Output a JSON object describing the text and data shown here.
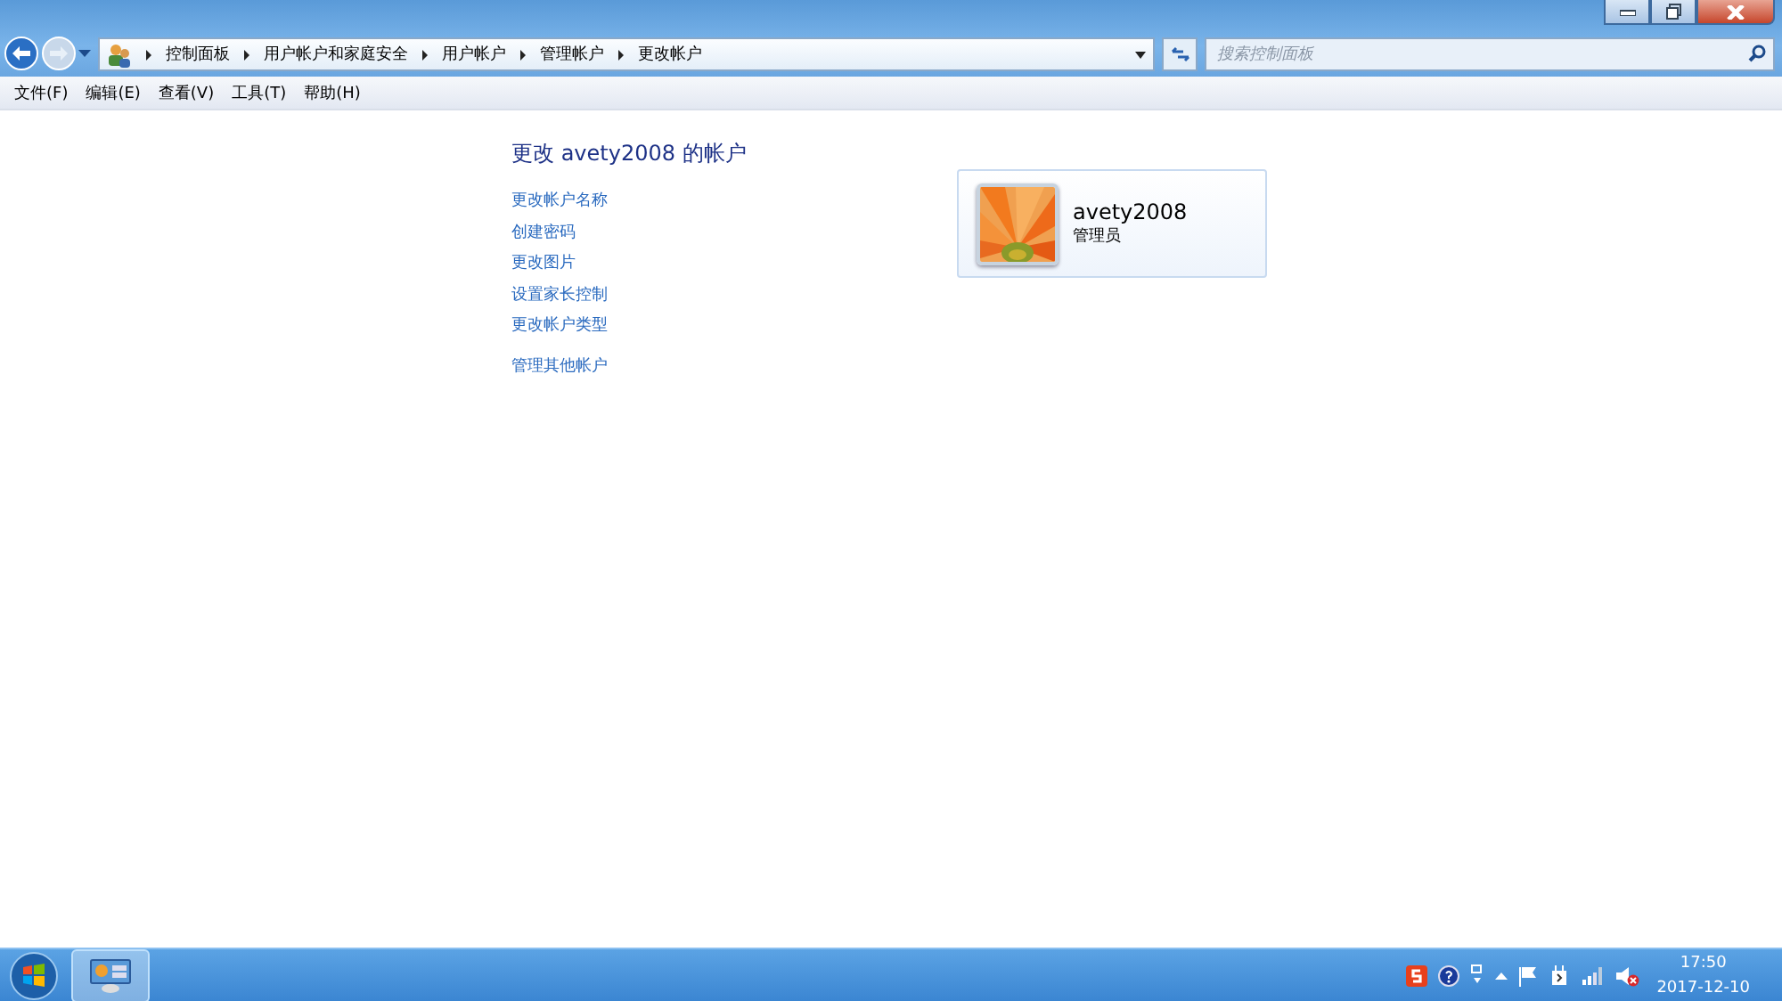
{
  "address_bar": {
    "breadcrumbs": [
      "控制面板",
      "用户帐户和家庭安全",
      "用户帐户",
      "管理帐户",
      "更改帐户"
    ]
  },
  "search": {
    "placeholder": "搜索控制面板"
  },
  "menu": [
    "文件(F)",
    "编辑(E)",
    "查看(V)",
    "工具(T)",
    "帮助(H)"
  ],
  "heading": "更改 avety2008 的帐户",
  "tasks": [
    "更改帐户名称",
    "创建密码",
    "更改图片",
    "设置家长控制",
    "更改帐户类型"
  ],
  "other_link": "管理其他帐户",
  "account": {
    "name": "avety2008",
    "role": "管理员"
  },
  "clock": {
    "time": "17:50",
    "date": "2017-12-10"
  }
}
